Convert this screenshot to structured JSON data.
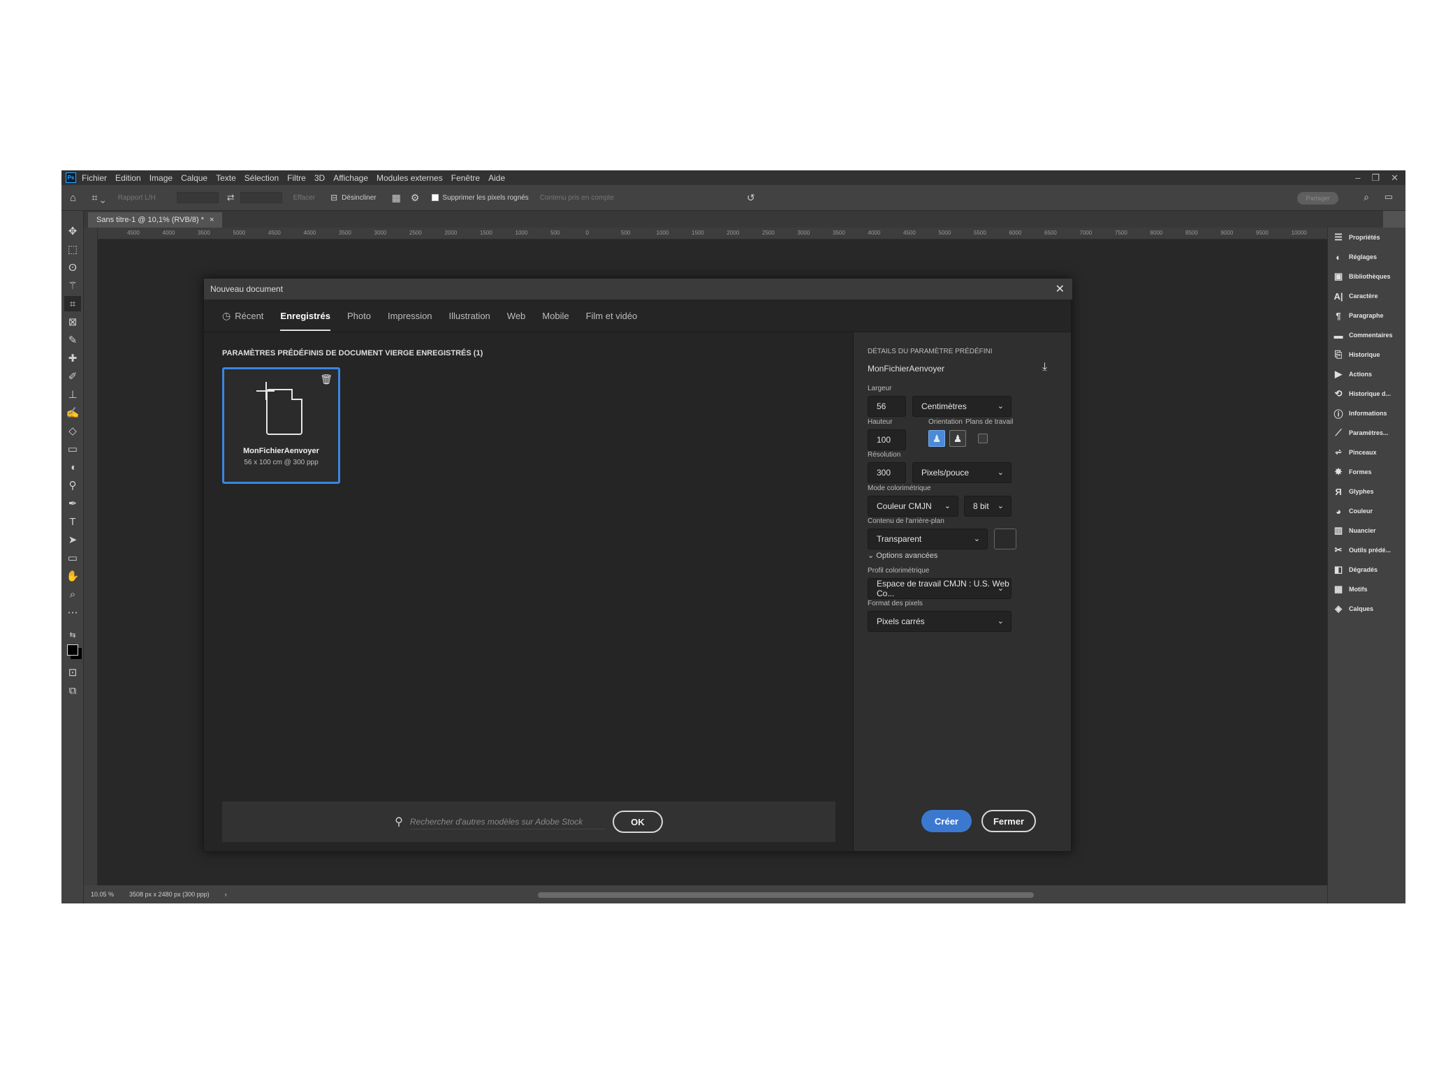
{
  "menubar": {
    "app_icon": "Ps",
    "items": [
      "Fichier",
      "Edition",
      "Image",
      "Calque",
      "Texte",
      "Sélection",
      "Filtre",
      "3D",
      "Affichage",
      "Modules externes",
      "Fenêtre",
      "Aide"
    ]
  },
  "options_bar": {
    "ratio_label": "Rapport L/H",
    "clear_label": "Effacer",
    "straighten_label": "Désincliner",
    "delete_cropped_label": "Supprimer les pixels rognés",
    "content_aware_label": "Contenu pris en compte",
    "share_label": "Partager"
  },
  "doc_tab": {
    "title": "Sans titre-1 @ 10,1% (RVB/8) *",
    "close": "×"
  },
  "ruler_top_ticks": [
    "4500",
    "4000",
    "3500",
    "5000",
    "4500",
    "4000",
    "3500",
    "3000",
    "2500",
    "2000",
    "1500",
    "1000",
    "500",
    "0",
    "500",
    "1000",
    "1500",
    "2000",
    "2500",
    "3000",
    "3500",
    "4000",
    "4500",
    "5000",
    "5500",
    "6000",
    "6500",
    "7000",
    "7500",
    "8000",
    "8500",
    "9000",
    "9500",
    "10000"
  ],
  "status": {
    "zoom": "10.05 %",
    "doc_info": "3508 px x 2480 px (300 ppp)"
  },
  "panels": [
    "Propriétés",
    "Réglages",
    "Bibliothèques",
    "Caractère",
    "Paragraphe",
    "Commentaires",
    "Historique",
    "Actions",
    "Historique d...",
    "Informations",
    "Paramètres...",
    "Pinceaux",
    "Formes",
    "Glyphes",
    "Couleur",
    "Nuancier",
    "Outils prédé...",
    "Dégradés",
    "Motifs",
    "Calques"
  ],
  "dialog": {
    "title": "Nouveau document",
    "tabs": [
      "Récent",
      "Enregistrés",
      "Photo",
      "Impression",
      "Illustration",
      "Web",
      "Mobile",
      "Film et vidéo"
    ],
    "active_tab": "Enregistrés",
    "presets_title": "PARAMÈTRES PRÉDÉFINIS DE DOCUMENT VIERGE ENREGISTRÉS (1)",
    "preset": {
      "name": "MonFichierAenvoyer",
      "size": "56 x 100 cm @ 300 ppp"
    },
    "search_placeholder": "Rechercher d'autres modèles sur Adobe Stock",
    "ok_label": "OK",
    "details": {
      "header": "DÉTAILS DU PARAMÈTRE PRÉDÉFINI",
      "preset_name": "MonFichierAenvoyer",
      "width_label": "Largeur",
      "width_value": "56",
      "unit": "Centimètres",
      "height_label": "Hauteur",
      "height_value": "100",
      "orientation_label": "Orientation",
      "artboards_label": "Plans de travail",
      "resolution_label": "Résolution",
      "resolution_value": "300",
      "resolution_unit": "Pixels/pouce",
      "color_mode_label": "Mode colorimétrique",
      "color_mode": "Couleur CMJN",
      "bit_depth": "8 bit",
      "background_label": "Contenu de l'arrière-plan",
      "background": "Transparent",
      "advanced_label": "Options avancées",
      "color_profile_label": "Profil colorimétrique",
      "color_profile": "Espace de travail CMJN : U.S. Web Co...",
      "pixel_aspect_label": "Format des pixels",
      "pixel_aspect": "Pixels carrés",
      "create_label": "Créer",
      "close_label": "Fermer"
    }
  }
}
